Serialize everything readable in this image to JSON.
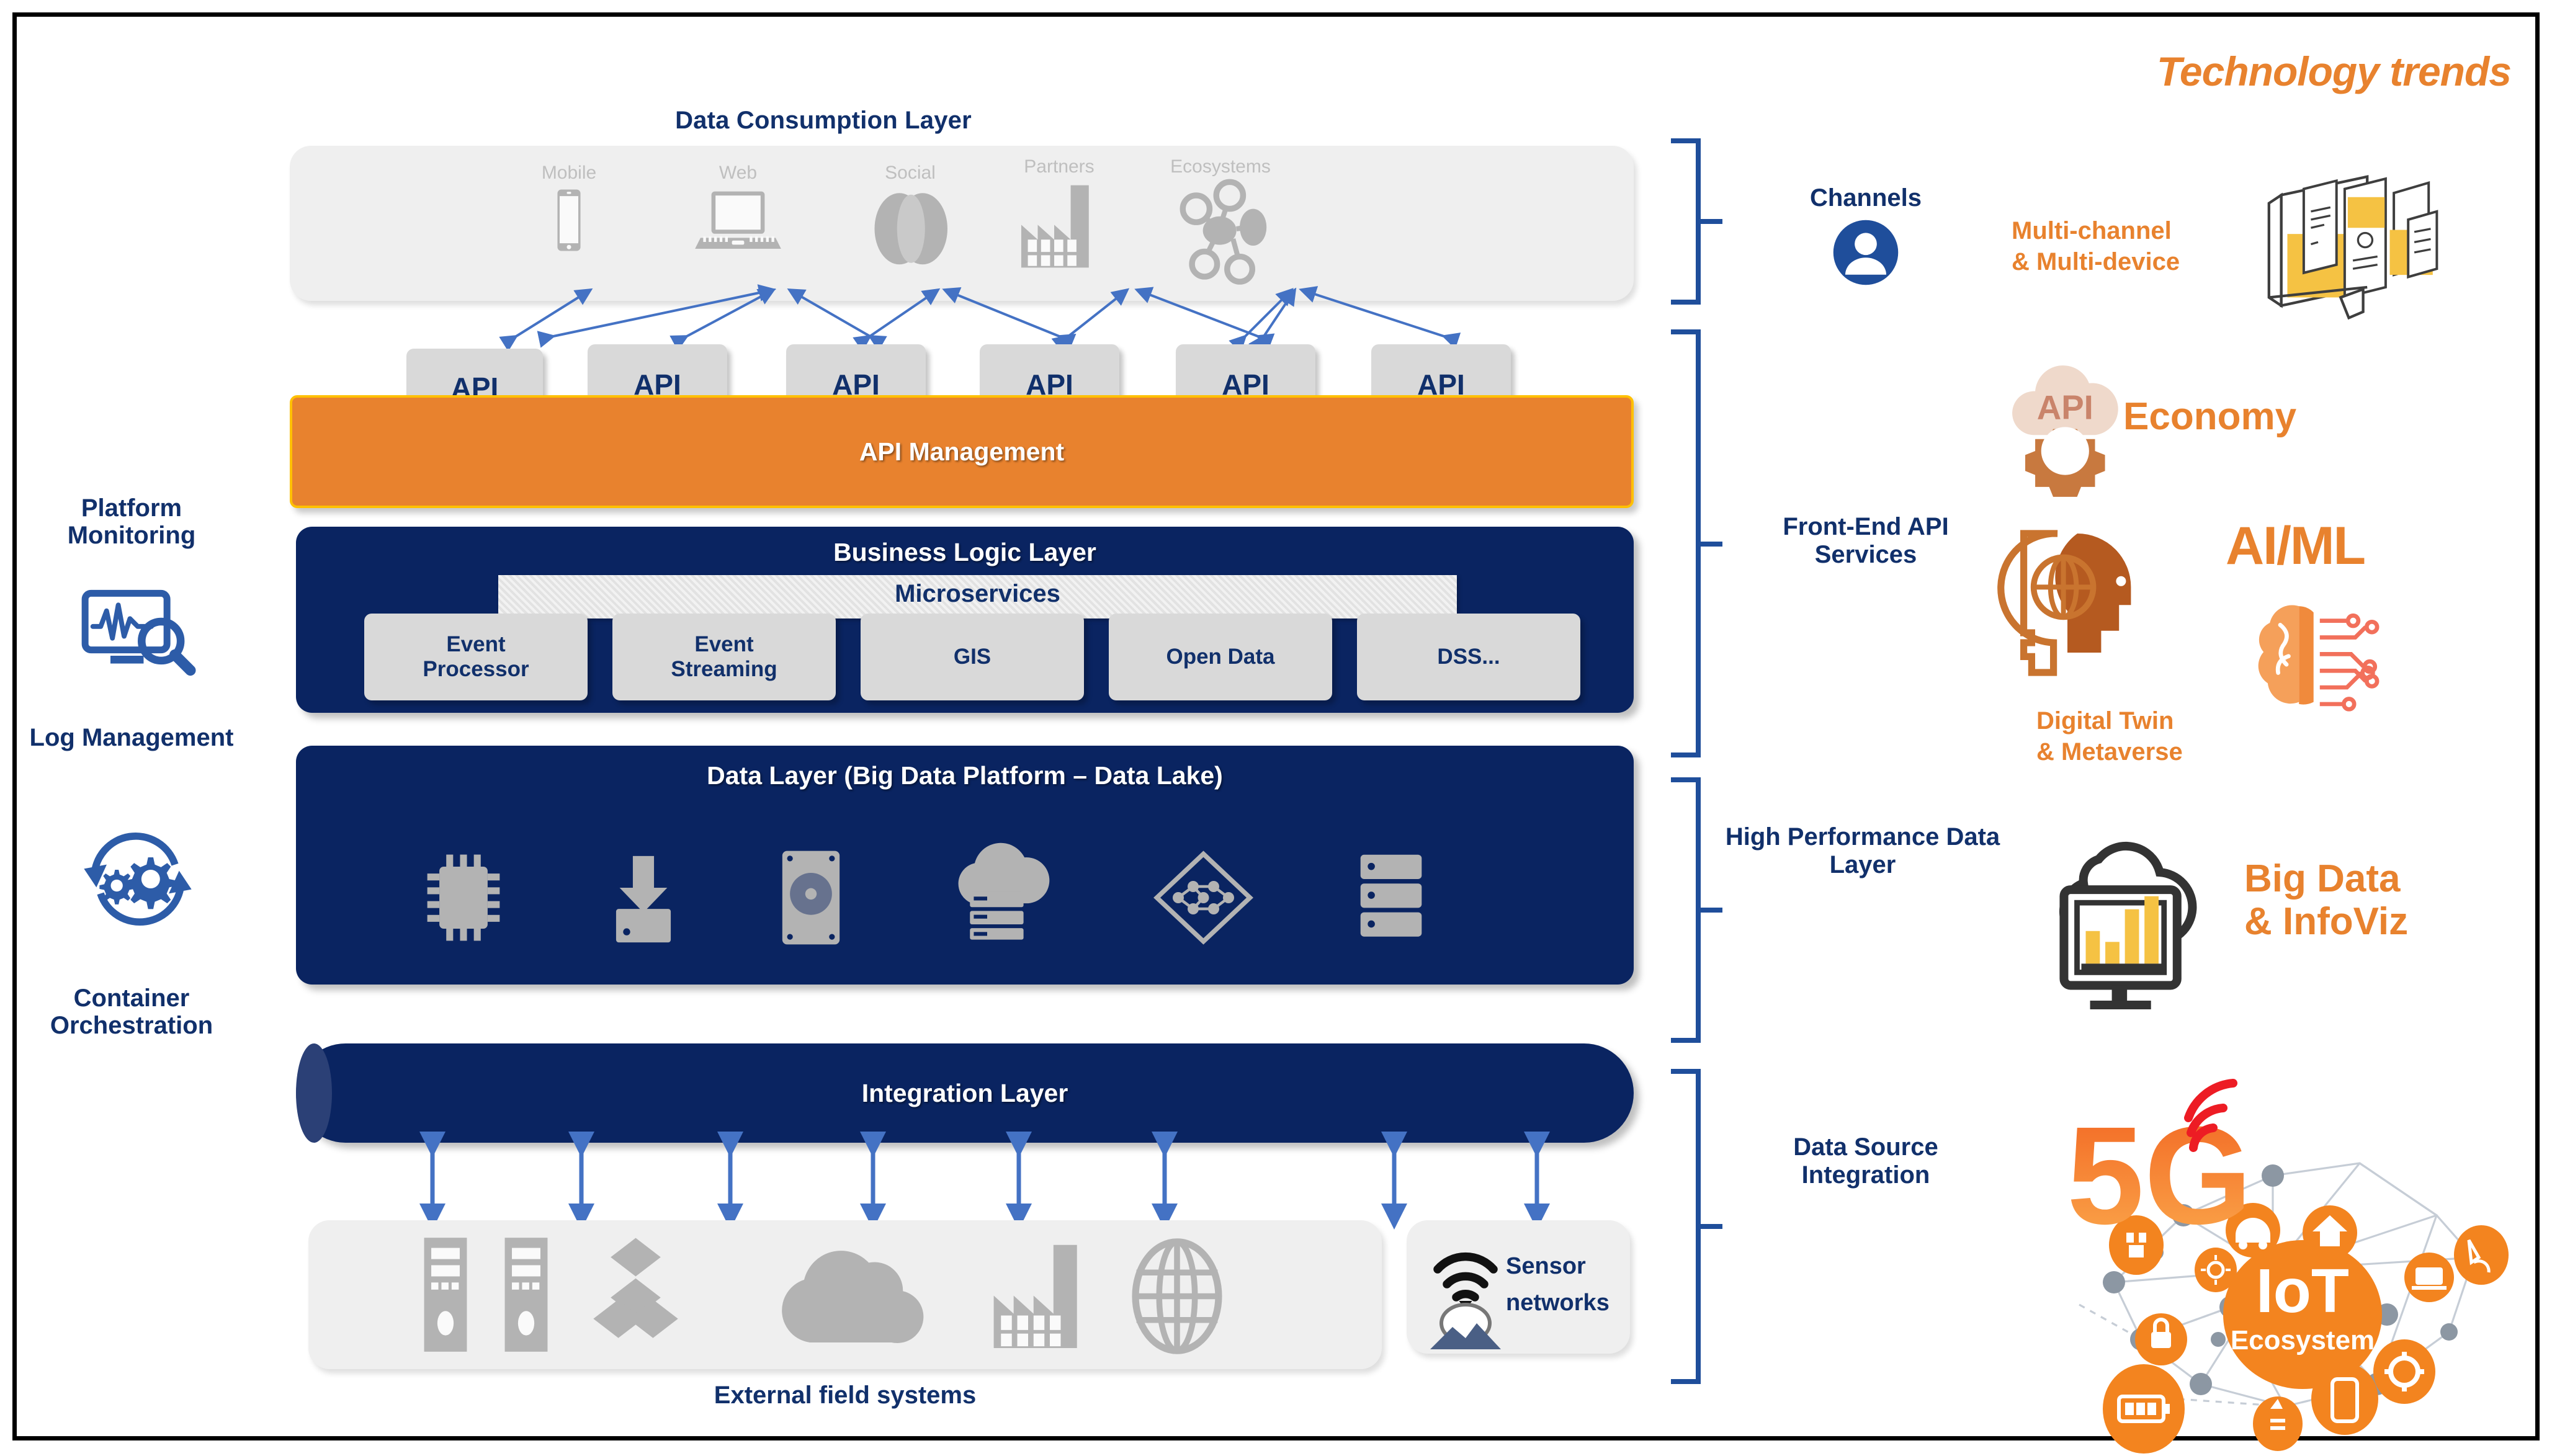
{
  "diagram": {
    "consumption_layer": {
      "title": "Data Consumption Layer",
      "channels": [
        {
          "label": "Mobile",
          "icon": "mobile-phone-icon"
        },
        {
          "label": "Web",
          "icon": "laptop-icon"
        },
        {
          "label": "Social",
          "icon": "social-circles-icon"
        },
        {
          "label": "Partners",
          "icon": "factory-icon"
        },
        {
          "label": "Ecosystems",
          "icon": "network-nodes-icon"
        }
      ]
    },
    "api_boxes": [
      {
        "label": "API"
      },
      {
        "label": "API"
      },
      {
        "label": "API"
      },
      {
        "label": "API"
      },
      {
        "label": "API"
      },
      {
        "label": "API"
      }
    ],
    "api_management": {
      "title": "API Management"
    },
    "business_logic": {
      "title": "Business Logic Layer",
      "microservices_band": "Microservices",
      "services": [
        {
          "label": "Event Processor"
        },
        {
          "label": "Event Streaming"
        },
        {
          "label": "GIS"
        },
        {
          "label": "Open Data"
        },
        {
          "label": "DSS..."
        }
      ]
    },
    "data_layer": {
      "title": "Data Layer (Big Data Platform – Data Lake)",
      "icons": [
        "cpu-chip-icon",
        "data-ingest-icon",
        "hard-disk-icon",
        "cloud-server-icon",
        "neural-network-icon",
        "database-stack-icon"
      ]
    },
    "integration_layer": {
      "title": "Integration Layer"
    },
    "external_systems": {
      "caption": "External field systems",
      "icons": [
        "server-tower-icon",
        "server-tower-icon",
        "cubes-icon",
        "cloud-icon",
        "factory-icon",
        "globe-icon"
      ]
    },
    "sensor_networks": {
      "label": "Sensor networks",
      "icon": "sensor-antenna-icon"
    },
    "left_column": [
      {
        "label": "Platform Monitoring",
        "icon": "monitor-search-icon"
      },
      {
        "label": "Log Management",
        "icon": "gear-cycle-icon"
      },
      {
        "label": "Container Orchestration",
        "icon": ""
      }
    ],
    "right_brackets": [
      {
        "label": "Channels",
        "icon": "user-avatar-icon"
      },
      {
        "label": "Front-End API Services",
        "icon": ""
      },
      {
        "label": "High Performance Data Layer",
        "icon": ""
      },
      {
        "label": "Data Source Integration",
        "icon": ""
      }
    ]
  },
  "trends": {
    "heading": "Technology trends",
    "items": [
      {
        "label": "Multi-channel & Multi-device",
        "line1": "Multi-channel",
        "line2": "& Multi-device",
        "icon": "multi-device-icon"
      },
      {
        "label": "API Economy",
        "word_icon": "API",
        "word_text": "Economy",
        "icon": "api-cloud-gear-icon"
      },
      {
        "label": "AI/ML",
        "big": "AI/ML",
        "icon": "brain-circuit-icon"
      },
      {
        "label": "Digital Twin & Metaverse",
        "line1": "Digital Twin",
        "line2": "& Metaverse",
        "icon": "digital-twin-head-icon"
      },
      {
        "label": "Big Data & InfoViz",
        "line1": "Big Data",
        "line2": "& InfoViz",
        "icon": "bigdata-monitor-icon"
      },
      {
        "label": "5G IoT Ecosystem",
        "big": "5G",
        "hub_line1": "IoT",
        "hub_line2": "Ecosystem",
        "icon": "iot-network-icon"
      }
    ]
  },
  "colors": {
    "navy": "#0A2461",
    "text_navy": "#11306B",
    "orange": "#E8822E",
    "gold_border": "#FFC000",
    "panel_grey": "#EFEFEF",
    "chip_grey": "#D9D9D9",
    "icon_grey": "#B3B3B3",
    "arrow_blue": "#4472C4"
  }
}
